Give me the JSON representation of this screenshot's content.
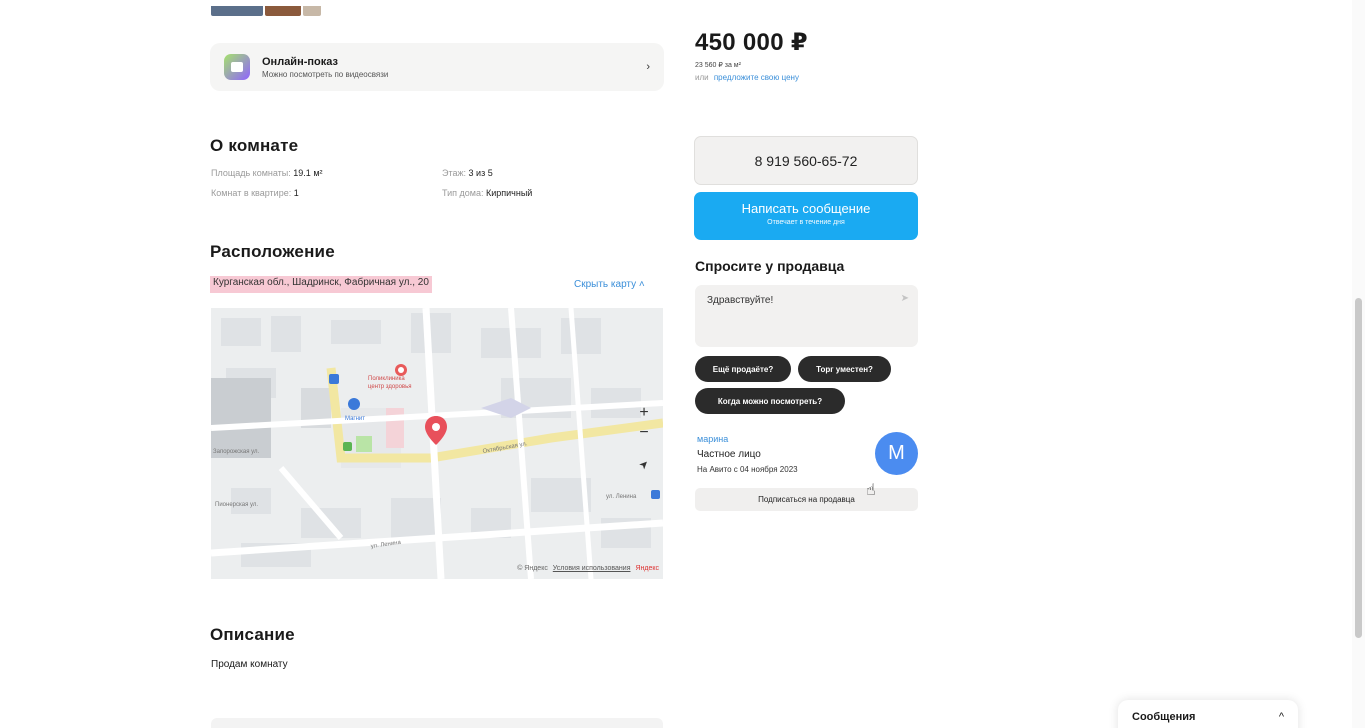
{
  "online_show": {
    "title": "Онлайн-показ",
    "subtitle": "Можно посмотреть по видеосвязи",
    "chevron": "›"
  },
  "room": {
    "title": "О комнате",
    "params": [
      {
        "label": "Площадь комнаты:",
        "value": "19.1 м²"
      },
      {
        "label": "Комнат в квартире:",
        "value": "1"
      },
      {
        "label": "Этаж:",
        "value": "3 из 5"
      },
      {
        "label": "Тип дома:",
        "value": "Кирпичный"
      }
    ]
  },
  "location": {
    "title": "Расположение",
    "address": "Курганская обл., Шадринск, Фабричная ул., 20",
    "hide_map": "Скрыть карту ˄",
    "map": {
      "labels": {
        "poly": "Поликлиника",
        "poly2": "центр здоровья",
        "street_oct": "Октябрьская ул.",
        "street_lenin": "ул. Ленина",
        "magnit": "Магнит",
        "street_left": "Запорожская ул.",
        "street_pioneer": "Пионерская ул.",
        "street_right": "ул. Ленина"
      },
      "zoom_in": "+",
      "zoom_out": "−",
      "locate": "➤",
      "footer_copy": "© Яндекс",
      "footer_terms": "Условия использования",
      "footer_brand": "Яндекс"
    }
  },
  "description": {
    "title": "Описание",
    "text": "Продам комнату"
  },
  "price": {
    "value": "450 000 ₽",
    "per_sqm": "23 560 ₽ за м²",
    "offer_prefix": "или",
    "offer_link": "предложите свою цену"
  },
  "contact": {
    "phone": "8 919 560-65-72",
    "message_button": "Написать сообщение",
    "message_sub": "Отвечает в течение дня"
  },
  "ask": {
    "title": "Спросите у продавца",
    "input_value": "Здравствуйте!",
    "send_icon": "➤",
    "chips": [
      "Ещё продаёте?",
      "Торг уместен?",
      "Когда можно посмотреть?"
    ]
  },
  "seller": {
    "name": "марина",
    "type": "Частное лицо",
    "since": "На Авито с 04 ноября 2023",
    "avatar_letter": "M",
    "subscribe": "Подписаться на продавца"
  },
  "messages_widget": {
    "label": "Сообщения",
    "chevron": "^"
  },
  "colors": {
    "accent": "#1aaaf2",
    "link": "#3b8fd9",
    "avatar": "#4b8cf0",
    "address_highlight": "#f7c9d4"
  }
}
